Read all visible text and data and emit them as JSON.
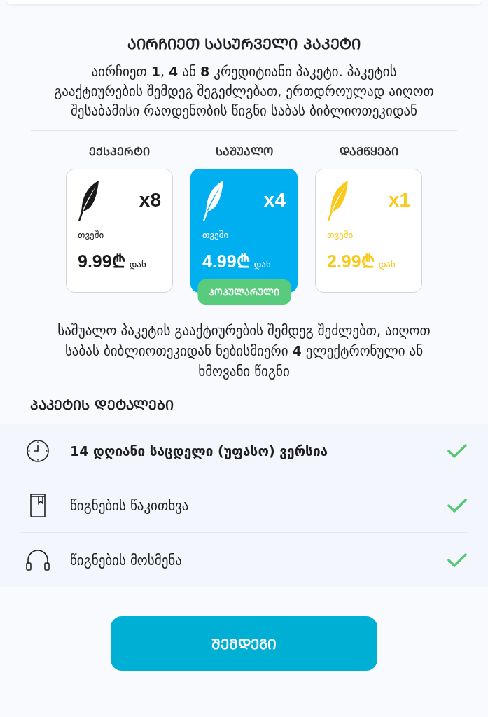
{
  "title": "ᲐᲘᲠᲩᲘᲔᲗ ᲡᲐᲡᲣᲠᲕᲔᲚᲘ ᲞᲐᲙᲔᲢᲘ",
  "intro": "აირჩიეთ **1**, **4** ან **8** კრედიტიანი პაკეტი. პაკეტის გააქტიურების შემდეგ შეგეძლებათ, ერთდროულად აიღოთ შესაბამისი რაოდენობის წიგნი საბას ბიბლიოთეკიდან",
  "packages": [
    {
      "tier": "ᲔᲥᲡᲞᲔᲠᲢᲘ",
      "multiplier": "x8",
      "period": "თვეში",
      "price": "9.99₾",
      "suffix": "დან",
      "color": "#1a1a1a",
      "selected": false
    },
    {
      "tier": "ᲡᲐᲨᲣᲐᲚᲝ",
      "multiplier": "x4",
      "period": "თვეში",
      "price": "4.99₾",
      "suffix": "დან",
      "color": "#ffffff",
      "selected": true,
      "badge": "ᲞᲝᲞᲣᲚᲐᲠᲣᲚᲘ"
    },
    {
      "tier": "ᲓᲐᲛᲬᲧᲔᲑᲘ",
      "multiplier": "x1",
      "period": "თვეში",
      "price": "2.99₾",
      "suffix": "დან",
      "color": "#f9c91c",
      "selected": false
    }
  ],
  "selected_info": "საშუალო პაკეტის გააქტიურების შემდეგ შეძლებთ, აიღოთ საბას ბიბლიოთეკიდან ნებისმიერი **4** ელექტრონული ან ხმოვანი წიგნი",
  "details": {
    "heading": "ᲞᲐᲙᲔᲢᲘᲡ ᲓᲔᲢᲐᲚᲔᲑᲘ",
    "features": [
      {
        "kind": "clock",
        "label": "14 დღიანი საცდელი (უფასო) ვერსია",
        "emphasized": true,
        "checked": true
      },
      {
        "kind": "book",
        "label": "წიგნების წაკითხვა",
        "emphasized": false,
        "checked": true
      },
      {
        "kind": "headphones",
        "label": "წიგნების მოსმენა",
        "emphasized": false,
        "checked": true
      }
    ]
  },
  "next_button": "ᲨᲔᲛᲓᲔᲒᲘ"
}
